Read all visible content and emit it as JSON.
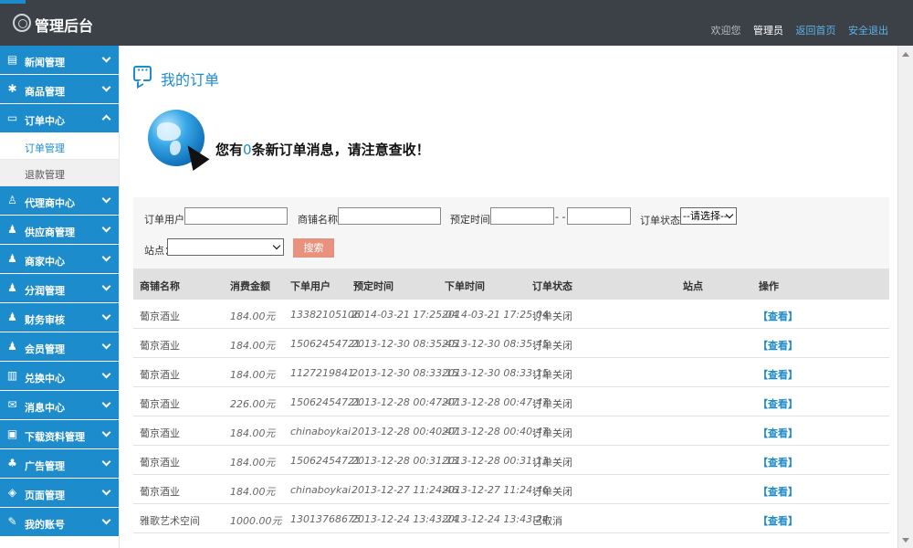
{
  "header": {
    "title": "管理后台",
    "welcome": "欢迎您",
    "user": "管理员",
    "home_link": "返回首页",
    "logout_link": "安全退出"
  },
  "sidebar": {
    "items": [
      {
        "label": "新闻管理",
        "icon": "document-icon"
      },
      {
        "label": "商品管理",
        "icon": "gear-icon"
      },
      {
        "label": "订单中心",
        "icon": "chat-icon"
      },
      {
        "label": "代理商中心",
        "icon": "person-outline-icon"
      },
      {
        "label": "供应商管理",
        "icon": "users-icon"
      },
      {
        "label": "商家中心",
        "icon": "users-icon"
      },
      {
        "label": "分润管理",
        "icon": "users-icon"
      },
      {
        "label": "财务审核",
        "icon": "users-icon"
      },
      {
        "label": "会员管理",
        "icon": "person-icon"
      },
      {
        "label": "兑换中心",
        "icon": "book-icon"
      },
      {
        "label": "消息中心",
        "icon": "mail-icon"
      },
      {
        "label": "下载资料管理",
        "icon": "download-icon"
      },
      {
        "label": "广告管理",
        "icon": "ad-icon"
      },
      {
        "label": "页面管理",
        "icon": "page-icon"
      },
      {
        "label": "我的账号",
        "icon": "account-icon"
      }
    ],
    "sub_items": [
      {
        "label": "订单管理"
      },
      {
        "label": "退款管理"
      }
    ]
  },
  "main": {
    "page_title": "我的订单",
    "notice_prefix": "您有",
    "notice_count": "0",
    "notice_suffix": "条新订单消息，请注意查收！"
  },
  "filter": {
    "user_label": "订单用户：",
    "shop_label": "商铺名称：",
    "time_label": "预定时间：",
    "time_sep": "- -",
    "status_label": "订单状态：",
    "status_value": "--请选择--",
    "site_label": "站点：",
    "site_value": "",
    "search_button": "搜索"
  },
  "table": {
    "headers": [
      "商铺名称",
      "消费金额",
      "下单用户",
      "预定时间",
      "下单时间",
      "订单状态",
      "站点",
      "操作"
    ],
    "rows": [
      {
        "shop": "葡京酒业",
        "amount": "184.00元",
        "user": "13382105106",
        "reserve": "2014-03-21 17:25:04",
        "order": "2014-03-21 17:25:04",
        "status": "订单关闭",
        "site": "",
        "op": "【查看】"
      },
      {
        "shop": "葡京酒业",
        "amount": "184.00元",
        "user": "15062454721",
        "reserve": "2013-12-30 08:35:45",
        "order": "2013-12-30 08:35:45",
        "status": "订单关闭",
        "site": "",
        "op": "【查看】"
      },
      {
        "shop": "葡京酒业",
        "amount": "184.00元",
        "user": "1127219841",
        "reserve": "2013-12-30 08:33:15",
        "order": "2013-12-30 08:33:15",
        "status": "订单关闭",
        "site": "",
        "op": "【查看】"
      },
      {
        "shop": "葡京酒业",
        "amount": "226.00元",
        "user": "15062454721",
        "reserve": "2013-12-28 00:47:47",
        "order": "2013-12-28 00:47:47",
        "status": "订单关闭",
        "site": "",
        "op": "【查看】"
      },
      {
        "shop": "葡京酒业",
        "amount": "184.00元",
        "user": "chinaboykai",
        "reserve": "2013-12-28 00:40:47",
        "order": "2013-12-28 00:40:47",
        "status": "订单关闭",
        "site": "",
        "op": "【查看】"
      },
      {
        "shop": "葡京酒业",
        "amount": "184.00元",
        "user": "15062454721",
        "reserve": "2013-12-28 00:31:13",
        "order": "2013-12-28 00:31:13",
        "status": "订单关闭",
        "site": "",
        "op": "【查看】"
      },
      {
        "shop": "葡京酒业",
        "amount": "184.00元",
        "user": "chinaboykai",
        "reserve": "2013-12-27 11:24:46",
        "order": "2013-12-27 11:24:46",
        "status": "订单关闭",
        "site": "",
        "op": "【查看】"
      },
      {
        "shop": "雅歌艺术空间",
        "amount": "1000.00元",
        "user": "13013768675",
        "reserve": "2013-12-24 13:43:24",
        "order": "2013-12-24 13:43:24",
        "status": "已取消",
        "site": "",
        "op": "【查看】"
      }
    ]
  },
  "colors": {
    "header_bg": "#3c4148",
    "sidebar_blue": "#1d8ccd",
    "accent": "#1d8ccd",
    "search_button": "#e8917e"
  }
}
